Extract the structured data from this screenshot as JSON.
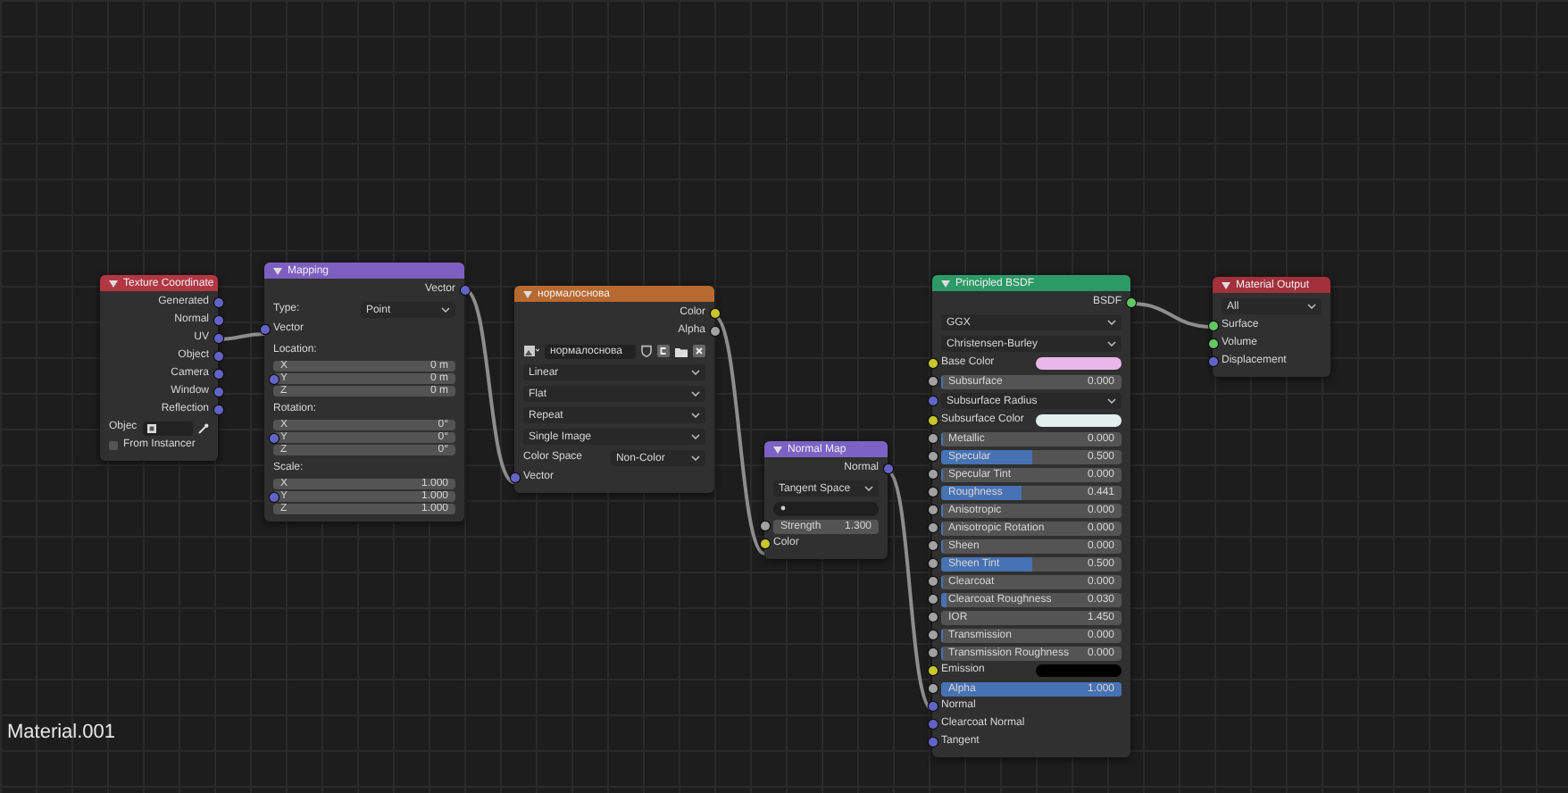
{
  "nodes": [
    {
      "title": "Texture Coordinate",
      "color": "#b23644",
      "rows": [
        {
          "kind": "output",
          "label": "Generated",
          "socket": {
            "color": "#6363c7"
          }
        },
        {
          "kind": "output",
          "label": "Normal",
          "socket": {
            "color": "#6363c7"
          }
        },
        {
          "kind": "output",
          "label": "UV",
          "socket": {
            "color": "#6363c7"
          }
        },
        {
          "kind": "output",
          "label": "Object",
          "socket": {
            "color": "#6363c7"
          }
        },
        {
          "kind": "output",
          "label": "Camera",
          "socket": {
            "color": "#6363c7"
          }
        },
        {
          "kind": "output",
          "label": "Window",
          "socket": {
            "color": "#6363c7"
          }
        },
        {
          "kind": "output",
          "label": "Reflection",
          "socket": {
            "color": "#6363c7"
          }
        },
        {
          "kind": "object",
          "label": "Objec"
        },
        {
          "kind": "checkbox",
          "label": "From Instancer",
          "checked": false
        }
      ]
    },
    {
      "title": "Mapping",
      "color": "#7d5fc2",
      "rows": [
        {
          "kind": "output",
          "label": "Vector",
          "socket": {
            "color": "#6363c7"
          }
        },
        {
          "kind": "dropdown",
          "label": "Type:",
          "value": "Point"
        },
        {
          "kind": "input",
          "label": "Vector",
          "socket": {
            "color": "#6363c7"
          }
        },
        {
          "kind": "vector",
          "label": "Location:",
          "socket": {
            "color": "#6363c7"
          },
          "fields": [
            {
              "axis": "X",
              "value": "0 m"
            },
            {
              "axis": "Y",
              "value": "0 m"
            },
            {
              "axis": "Z",
              "value": "0 m"
            }
          ]
        },
        {
          "kind": "vector",
          "label": "Rotation:",
          "socket": {
            "color": "#6363c7"
          },
          "fields": [
            {
              "axis": "X",
              "value": "0°"
            },
            {
              "axis": "Y",
              "value": "0°"
            },
            {
              "axis": "Z",
              "value": "0°"
            }
          ]
        },
        {
          "kind": "vector",
          "label": "Scale:",
          "socket": {
            "color": "#6363c7"
          },
          "fields": [
            {
              "axis": "X",
              "value": "1.000"
            },
            {
              "axis": "Y",
              "value": "1.000"
            },
            {
              "axis": "Z",
              "value": "1.000"
            }
          ]
        }
      ]
    },
    {
      "title": "нормалоснова",
      "color": "#b8692f",
      "rows": [
        {
          "kind": "output",
          "label": "Color",
          "socket": {
            "color": "#c7c729"
          }
        },
        {
          "kind": "output",
          "label": "Alpha",
          "socket": {
            "color": "#a1a1a1"
          }
        },
        {
          "kind": "image",
          "value": "нормалоснова"
        },
        {
          "kind": "dropdown",
          "value": "Linear"
        },
        {
          "kind": "dropdown",
          "value": "Flat"
        },
        {
          "kind": "dropdown",
          "value": "Repeat"
        },
        {
          "kind": "dropdown",
          "value": "Single Image"
        },
        {
          "kind": "dropdown",
          "label": "Color Space",
          "value": "Non-Color"
        },
        {
          "kind": "input",
          "label": "Vector",
          "socket": {
            "color": "#6363c7"
          }
        }
      ]
    },
    {
      "title": "Normal Map",
      "color": "#7c62c4",
      "rows": [
        {
          "kind": "output",
          "label": "Normal",
          "socket": {
            "color": "#6363c7"
          }
        },
        {
          "kind": "dropdown",
          "value": "Tangent Space"
        },
        {
          "kind": "uvmap"
        },
        {
          "kind": "field",
          "label": "Strength",
          "value": "1.300",
          "socket": {
            "color": "#a1a1a1"
          }
        },
        {
          "kind": "input",
          "label": "Color",
          "socket": {
            "color": "#c7c729"
          }
        }
      ]
    },
    {
      "title": "Principled BSDF",
      "color": "#2b9a67",
      "rows": [
        {
          "kind": "output",
          "label": "BSDF",
          "socket": {
            "color": "#63c763"
          }
        },
        {
          "kind": "dropdown",
          "value": "GGX"
        },
        {
          "kind": "dropdown",
          "value": "Christensen-Burley"
        },
        {
          "kind": "color",
          "label": "Base Color",
          "socket": {
            "color": "#c7c729"
          },
          "color": "#eab8e8"
        },
        {
          "kind": "slider",
          "label": "Subsurface",
          "value": "0.000",
          "level": 0,
          "socket": {
            "color": "#a1a1a1"
          }
        },
        {
          "kind": "dropdown",
          "label": "Subsurface Radius",
          "socket": {
            "color": "#6363c7"
          }
        },
        {
          "kind": "color",
          "label": "Subsurface Color",
          "socket": {
            "color": "#c7c729"
          },
          "color": "#e3efef"
        },
        {
          "kind": "slider",
          "label": "Metallic",
          "value": "0.000",
          "level": 0,
          "socket": {
            "color": "#a1a1a1"
          }
        },
        {
          "kind": "slider",
          "label": "Specular",
          "value": "0.500",
          "level": 0.5,
          "socket": {
            "color": "#a1a1a1"
          }
        },
        {
          "kind": "slider",
          "label": "Specular Tint",
          "value": "0.000",
          "level": 0,
          "socket": {
            "color": "#a1a1a1"
          }
        },
        {
          "kind": "slider",
          "label": "Roughness",
          "value": "0.441",
          "level": 0.441,
          "socket": {
            "color": "#a1a1a1"
          }
        },
        {
          "kind": "slider",
          "label": "Anisotropic",
          "value": "0.000",
          "level": 0,
          "socket": {
            "color": "#a1a1a1"
          }
        },
        {
          "kind": "slider",
          "label": "Anisotropic Rotation",
          "value": "0.000",
          "level": 0,
          "socket": {
            "color": "#a1a1a1"
          }
        },
        {
          "kind": "slider",
          "label": "Sheen",
          "value": "0.000",
          "level": 0,
          "socket": {
            "color": "#a1a1a1"
          }
        },
        {
          "kind": "slider",
          "label": "Sheen Tint",
          "value": "0.500",
          "level": 0.5,
          "socket": {
            "color": "#a1a1a1"
          }
        },
        {
          "kind": "slider",
          "label": "Clearcoat",
          "value": "0.000",
          "level": 0,
          "socket": {
            "color": "#a1a1a1"
          }
        },
        {
          "kind": "slider",
          "label": "Clearcoat Roughness",
          "value": "0.030",
          "level": 0.03,
          "socket": {
            "color": "#a1a1a1"
          }
        },
        {
          "kind": "field",
          "label": "IOR",
          "value": "1.450",
          "socket": {
            "color": "#a1a1a1"
          }
        },
        {
          "kind": "slider",
          "label": "Transmission",
          "value": "0.000",
          "level": 0,
          "socket": {
            "color": "#a1a1a1"
          }
        },
        {
          "kind": "slider",
          "label": "Transmission Roughness",
          "value": "0.000",
          "level": 0,
          "socket": {
            "color": "#a1a1a1"
          }
        },
        {
          "kind": "color",
          "label": "Emission",
          "socket": {
            "color": "#c7c729"
          },
          "color": "#000000"
        },
        {
          "kind": "slider",
          "label": "Alpha",
          "value": "1.000",
          "level": 1,
          "socket": {
            "color": "#a1a1a1"
          }
        },
        {
          "kind": "input",
          "label": "Normal",
          "socket": {
            "color": "#6363c7"
          }
        },
        {
          "kind": "input",
          "label": "Clearcoat Normal",
          "socket": {
            "color": "#6363c7"
          }
        },
        {
          "kind": "input",
          "label": "Tangent",
          "socket": {
            "color": "#6363c7"
          }
        }
      ]
    },
    {
      "title": "Material Output",
      "color": "#a3303c",
      "rows": [
        {
          "kind": "dropdown",
          "value": "All"
        },
        {
          "kind": "input",
          "label": "Surface",
          "socket": {
            "color": "#63c763"
          }
        },
        {
          "kind": "input",
          "label": "Volume",
          "socket": {
            "color": "#63c763"
          }
        },
        {
          "kind": "input",
          "label": "Displacement",
          "socket": {
            "color": "#6363c7"
          }
        }
      ]
    }
  ],
  "material_name": "Material.001"
}
